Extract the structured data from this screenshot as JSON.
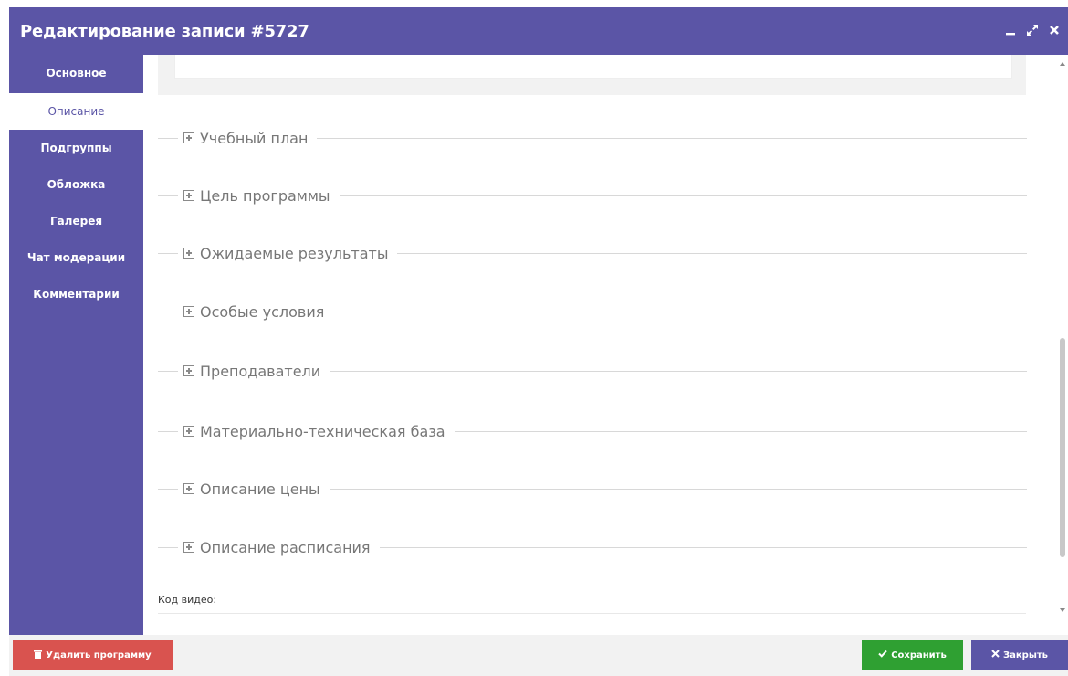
{
  "window": {
    "title": "Редактирование записи #5727",
    "controls": [
      "minimize-icon",
      "expand-icon",
      "close-icon"
    ]
  },
  "sidebar": {
    "items": [
      {
        "label": "Основное",
        "active": false
      },
      {
        "label": "Описание",
        "active": true
      },
      {
        "label": "Подгруппы",
        "active": false
      },
      {
        "label": "Обложка",
        "active": false
      },
      {
        "label": "Галерея",
        "active": false
      },
      {
        "label": "Чат модерации",
        "active": false
      },
      {
        "label": "Комментарии",
        "active": false
      }
    ]
  },
  "sections": [
    {
      "title": "Учебный план",
      "expand_icon": "plus-square-icon"
    },
    {
      "title": "Цель программы",
      "expand_icon": "plus-square-icon"
    },
    {
      "title": "Ожидаемые результаты",
      "expand_icon": "plus-square-icon"
    },
    {
      "title": "Особые условия",
      "expand_icon": "plus-square-icon"
    },
    {
      "title": "Преподаватели",
      "expand_icon": "plus-square-icon"
    },
    {
      "title": "Материально-техническая база",
      "expand_icon": "plus-square-icon"
    },
    {
      "title": "Описание цены",
      "expand_icon": "plus-square-icon"
    },
    {
      "title": "Описание расписания",
      "expand_icon": "plus-square-icon"
    }
  ],
  "video": {
    "label": "Код видео:"
  },
  "footer": {
    "delete_label": "Удалить программу",
    "delete_icon": "trash-icon",
    "save_label": "Сохранить",
    "save_icon": "check-icon",
    "close_label": "Закрыть",
    "close_icon": "times-icon"
  },
  "colors": {
    "primary": "#5b55a6",
    "danger": "#d9534f",
    "success": "#2fa032"
  }
}
